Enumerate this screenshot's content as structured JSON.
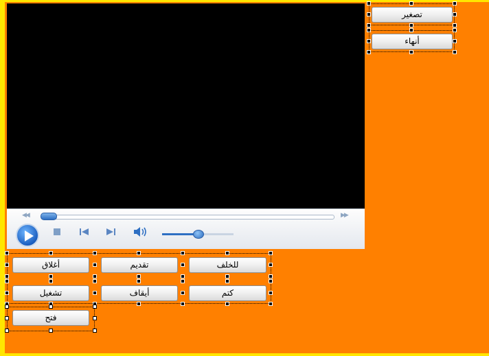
{
  "form": {
    "background_color": "#FF8000",
    "frame_color": "#FFE600"
  },
  "player": {
    "screen_color": "#000000",
    "seek_position": 0.05,
    "volume_level": 0.5,
    "icons": [
      "rewind-icon",
      "fast-forward-icon",
      "play-icon",
      "stop-icon",
      "previous-icon",
      "next-icon",
      "volume-icon"
    ]
  },
  "buttons": {
    "minimize": "تصغير",
    "terminate": "أنهاء",
    "close": "أغلاق",
    "forward": "تقديم",
    "backward": "للخلف",
    "play": "تشغيل",
    "pause": "أيقاف",
    "mute": "كتم",
    "open": "فتح"
  }
}
